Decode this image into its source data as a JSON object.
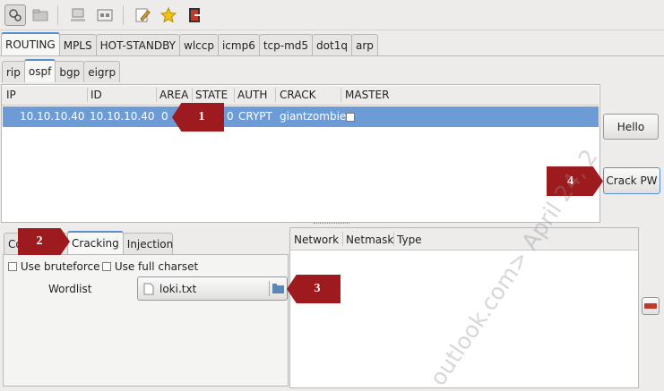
{
  "toolbar": {
    "icons": [
      "plugins-icon",
      "folder-icon",
      "network-icon",
      "image-icon",
      "edit-icon",
      "star-icon",
      "exit-icon"
    ]
  },
  "main_tabs": [
    "ROUTING",
    "MPLS",
    "HOT-STANDBY",
    "wlccp",
    "icmp6",
    "tcp-md5",
    "dot1q",
    "arp"
  ],
  "routing_tabs": [
    "rip",
    "ospf",
    "bgp",
    "eigrp"
  ],
  "table": {
    "columns": [
      "IP",
      "ID",
      "AREA",
      "STATE",
      "AUTH",
      "CRACK",
      "MASTER"
    ],
    "row": {
      "ip": "10.10.10.40",
      "id": "10.10.10.40",
      "area": "0",
      "state": "0",
      "auth": "CRYPT",
      "crack": "giantzombie"
    }
  },
  "buttons": {
    "hello": "Hello",
    "crack_pw": "Crack PW"
  },
  "lower_tabs": [
    "Co",
    "Cracking",
    "Injection"
  ],
  "cracking": {
    "use_bruteforce": "Use bruteforce",
    "use_full_charset": "Use full charset",
    "wordlist_label": "Wordlist",
    "wordlist_value": "loki.txt"
  },
  "network_table": {
    "columns": [
      "Network",
      "Netmask",
      "Type"
    ]
  },
  "callouts": [
    "1",
    "2",
    "3",
    "4"
  ],
  "watermark": "outlook.com> April 24, 2"
}
